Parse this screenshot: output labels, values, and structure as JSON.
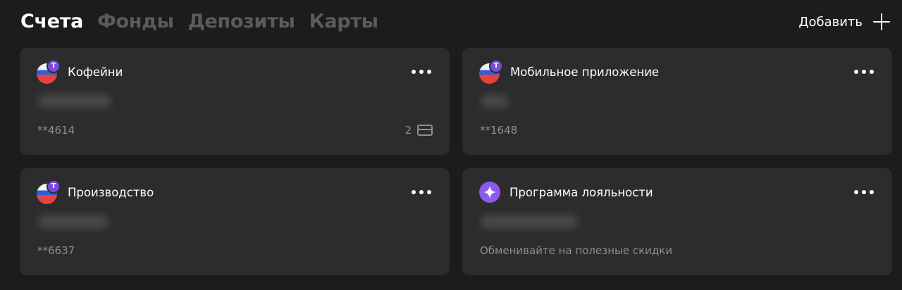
{
  "tabs": [
    {
      "label": "Счета",
      "active": true
    },
    {
      "label": "Фонды",
      "active": false
    },
    {
      "label": "Депозиты",
      "active": false
    },
    {
      "label": "Карты",
      "active": false
    }
  ],
  "add_label": "Добавить",
  "colors": {
    "background": "#1c1c1e",
    "card": "#2c2c2e",
    "accent": "#7b4cdc",
    "secondary_text": "#8e8e93",
    "inactive_tab": "#5b5b5e"
  },
  "cards": [
    {
      "title": "Кофейни",
      "icon": "ru-flag-tbank-icon",
      "subtitle": "**4614",
      "cards_count": "2"
    },
    {
      "title": "Мобильное приложение",
      "icon": "ru-flag-tbank-icon",
      "subtitle": "**1648"
    },
    {
      "title": "Производство",
      "icon": "ru-flag-tbank-icon",
      "subtitle": "**6637"
    },
    {
      "title": "Программа лояльности",
      "icon": "sparkle-icon",
      "subtitle": "Обменивайте на полезные скидки"
    }
  ]
}
